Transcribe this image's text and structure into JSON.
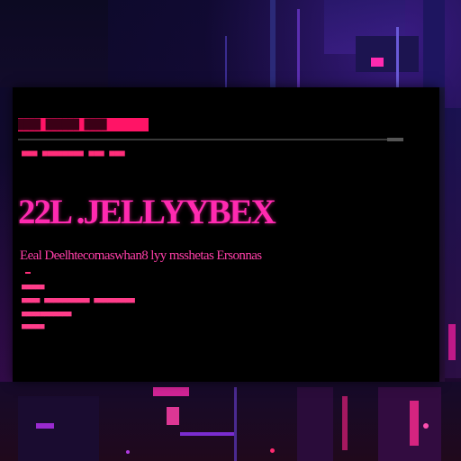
{
  "window": {
    "title_strip": "████ ██████ ████",
    "meta_line": "■■■ ■■■■■■■■ ■■■ ■■■",
    "headline": "22L .JELLYYBEX",
    "subline": "Eeal  Deelhtecomaswhan8 lyy  msshetas  Ersonnas",
    "details": [
      "■■■■■",
      "■■■■ ■■■■■■■■■■ ■■■■■■■■■",
      "■■■■■■■■■■■",
      "■■■■■"
    ]
  },
  "colors": {
    "accent_magenta": "#ff2ab0",
    "accent_red": "#ff1466",
    "background": "#0a0614"
  }
}
